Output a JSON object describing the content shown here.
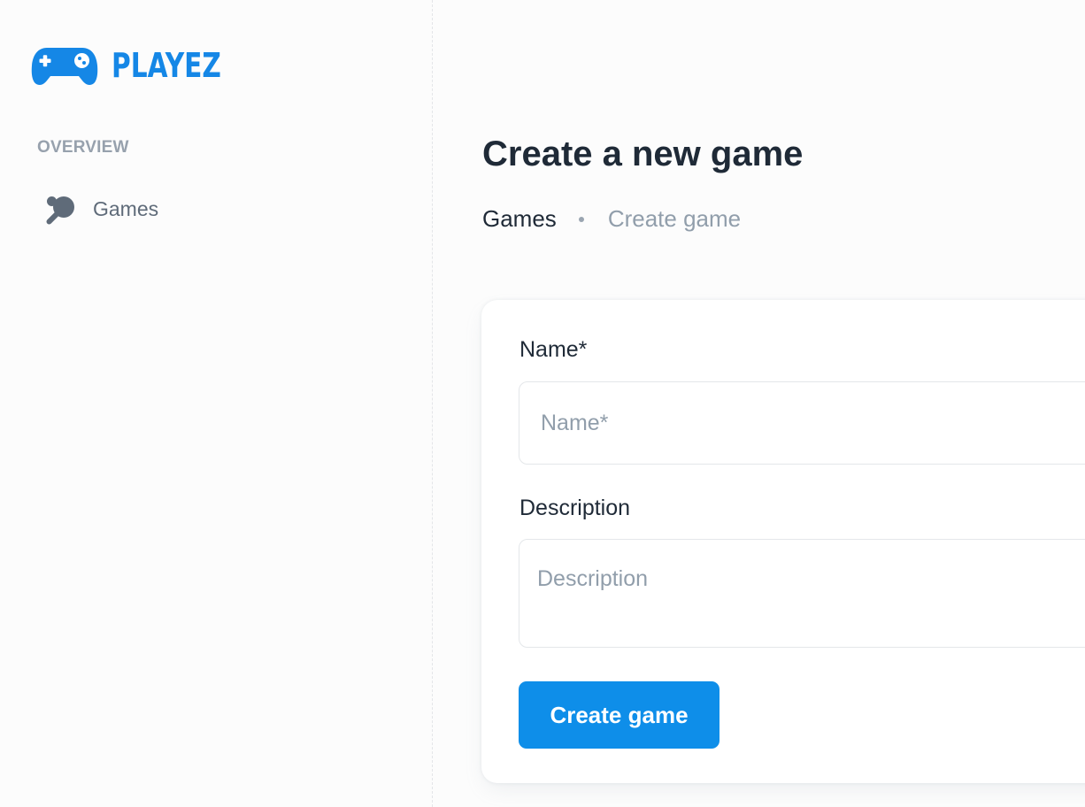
{
  "brand": {
    "name": "PLAYEZ",
    "icon": "gamepad-icon",
    "color": "#1587e6"
  },
  "sidebar": {
    "section_label": "OVERVIEW",
    "items": [
      {
        "label": "Games",
        "icon": "ping-pong-paddle-icon"
      }
    ]
  },
  "main": {
    "title": "Create a new game",
    "breadcrumb": {
      "link": "Games",
      "current": "Create game"
    },
    "form": {
      "name": {
        "label": "Name*",
        "placeholder": "Name*",
        "value": ""
      },
      "description": {
        "label": "Description",
        "placeholder": "Description",
        "value": ""
      },
      "submit_label": "Create game"
    }
  },
  "colors": {
    "accent": "#0e8ee9",
    "text_primary": "#1f2a37",
    "text_muted": "#919eab"
  }
}
